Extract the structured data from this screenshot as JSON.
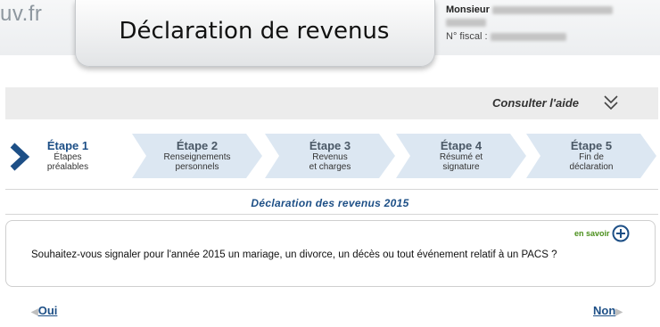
{
  "header": {
    "logo_text": "uv.fr",
    "title": "Déclaration de revenus",
    "user_label": "Monsieur",
    "fiscal_label": "N° fiscal :"
  },
  "help": {
    "label": "Consulter l'aide",
    "icon": "double-chevron-down-icon"
  },
  "steps": [
    {
      "title": "Étape 1",
      "line1": "Étapes",
      "line2": "préalables",
      "active": true
    },
    {
      "title": "Étape 2",
      "line1": "Renseignements",
      "line2": "personnels",
      "active": false
    },
    {
      "title": "Étape 3",
      "line1": "Revenus",
      "line2": "et charges",
      "active": false
    },
    {
      "title": "Étape 4",
      "line1": "Résumé et",
      "line2": "signature",
      "active": false
    },
    {
      "title": "Étape 5",
      "line1": "Fin de",
      "line2": "déclaration",
      "active": false
    }
  ],
  "declaration_title": "Déclaration des revenus 2015",
  "panel": {
    "more_label": "en savoir",
    "more_icon": "plus-circle-icon",
    "question": "Souhaitez-vous signaler pour l'année 2015 un mariage, un divorce, un décès ou tout événement relatif à un PACS ?"
  },
  "nav": {
    "yes_label": "Oui",
    "no_label": "Non"
  },
  "colors": {
    "primary": "#1d4f86",
    "step_fill": "#dce7f2",
    "accent_green": "#4a8f1b"
  }
}
